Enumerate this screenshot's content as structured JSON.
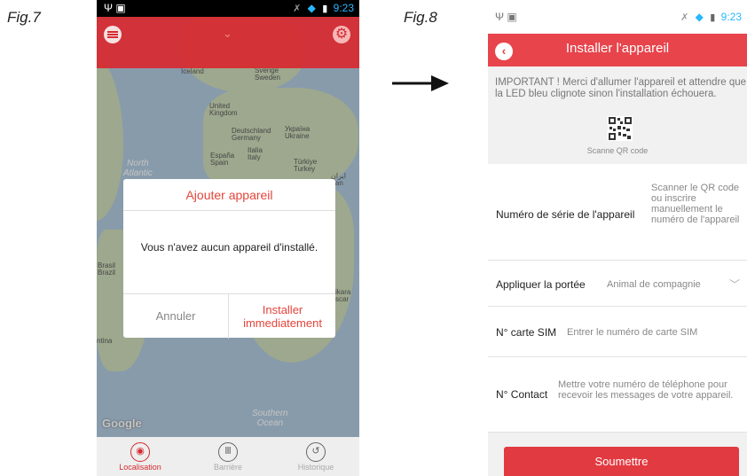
{
  "figures": {
    "fig7_label": "Fig.7",
    "fig8_label": "Fig.8"
  },
  "statusbar": {
    "time": "9:23"
  },
  "screen1": {
    "map_labels": {
      "iceland": "Iceland",
      "sweden": "Sverige\nSweden",
      "uk": "United\nKingdom",
      "germany": "Deutschland\nGermany",
      "ukraine": "Україна\nUkraine",
      "spain": "España\nSpain",
      "italy": "Italia\nItaly",
      "turkey": "Türkiye\nTurkey",
      "iran": "ایران\nIran",
      "brazil": "Brasil\nBrazil",
      "madagascar": "ikara\nscar",
      "argentina": "ntina",
      "north_atlantic": "North\nAtlantic",
      "southern_ocean": "Southern\nOcean",
      "google": "Google"
    },
    "dialog": {
      "title": "Ajouter appareil",
      "message": "Vous n'avez aucun appareil d'installé.",
      "cancel_label": "Annuler",
      "install_label": "Installer\nimmediatement"
    },
    "bottom_nav": [
      {
        "label": "Localisation",
        "icon": "location-pin-icon",
        "active": true
      },
      {
        "label": "Barrière",
        "icon": "fence-icon",
        "active": false
      },
      {
        "label": "Historique",
        "icon": "history-icon",
        "active": false
      }
    ],
    "colors": {
      "accent": "#d42a2f"
    }
  },
  "screen2": {
    "title": "Installer l'appareil",
    "notice": "IMPORTANT ! Merci d'allumer l'appareil et attendre que la LED bleu clignote sinon l'installation échouera.",
    "qr_label": "Scanne QR code",
    "fields": {
      "serial": {
        "label": "Numéro de série de l'appareil",
        "placeholder": "Scanner le QR code ou inscrire manuellement le numéro de l'appareil"
      },
      "range": {
        "label": "Appliquer la portée",
        "value": "Animal de compagnie"
      },
      "sim": {
        "label": "N° carte SIM",
        "placeholder": "Entrer le numéro de carte SIM"
      },
      "contact": {
        "label": "N° Contact",
        "placeholder": "Mettre votre numéro de téléphone pour recevoir les messages de votre appareil."
      }
    },
    "submit_label": "Soumettre",
    "colors": {
      "accent": "#e7444b"
    }
  }
}
